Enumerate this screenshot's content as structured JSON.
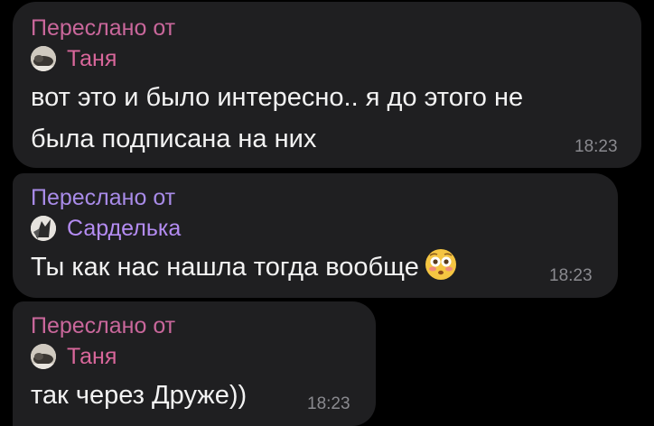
{
  "messages": [
    {
      "forwarded_label": "Переслано от",
      "author": "Таня",
      "author_color": "#d9679b",
      "text_lines": [
        "вот это и было интересно.. я  до этого не",
        "была подписана на них"
      ],
      "time": "18:23",
      "avatar_icon": "avatar-photo-icon"
    },
    {
      "forwarded_label": "Переслано от",
      "author": "Сарделька",
      "author_color": "#b48cf2",
      "text": "Ты как нас нашла тогда вообще",
      "emoji": "flushed-face-icon",
      "time": "18:23",
      "avatar_icon": "avatar-photo-icon"
    },
    {
      "forwarded_label": "Переслано от",
      "author": "Таня",
      "author_color": "#d9679b",
      "text": "так через Друже))",
      "time": "18:23",
      "avatar_icon": "avatar-photo-icon"
    }
  ],
  "colors": {
    "background": "#000000",
    "bubble": "#1f1f21",
    "forwarded_label_tanya": "#c9679b",
    "forwarded_label_sardelka": "#a88be8",
    "text": "#f2f2f2",
    "time": "#8a8a8f"
  }
}
